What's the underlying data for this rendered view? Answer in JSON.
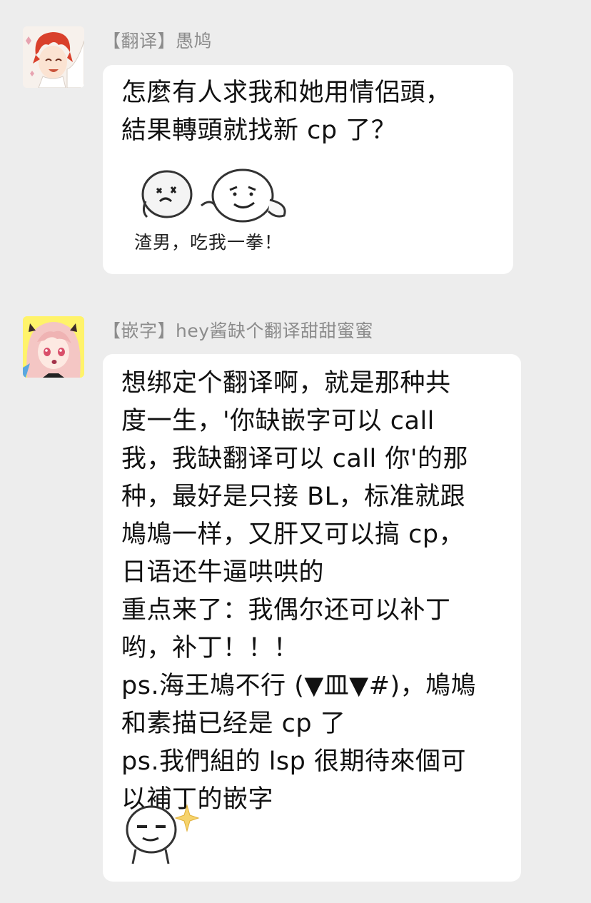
{
  "messages": [
    {
      "sender": "【翻译】愚鸠",
      "text": "怎麼有人求我和她用情侶頭，\n結果轉頭就找新 cp 了？",
      "sticker_caption": "渣男，吃我一拳！"
    },
    {
      "sender": "【嵌字】hey酱缺个翻译甜甜蜜蜜",
      "text": "想绑定个翻译啊，就是那种共\n度一生，'你缺嵌字可以 call\n我，我缺翻译可以 call 你'的那\n种，最好是只接 BL，标准就跟\n鳩鳩一样，又肝又可以搞 cp，\n日语还牛逼哄哄的\n重点来了：我偶尔还可以补丁\n哟，补丁！！！\nps.海王鳩不行 (▼皿▼#)，鳩鳩\n和素描已经是 cp 了\nps.我們組的 lsp 很期待來個可\n以補丁的嵌字"
    }
  ],
  "colors": {
    "background": "#ededed",
    "bubble": "#ffffff",
    "sender_name": "#8c8c8c",
    "message_text": "#111111"
  }
}
